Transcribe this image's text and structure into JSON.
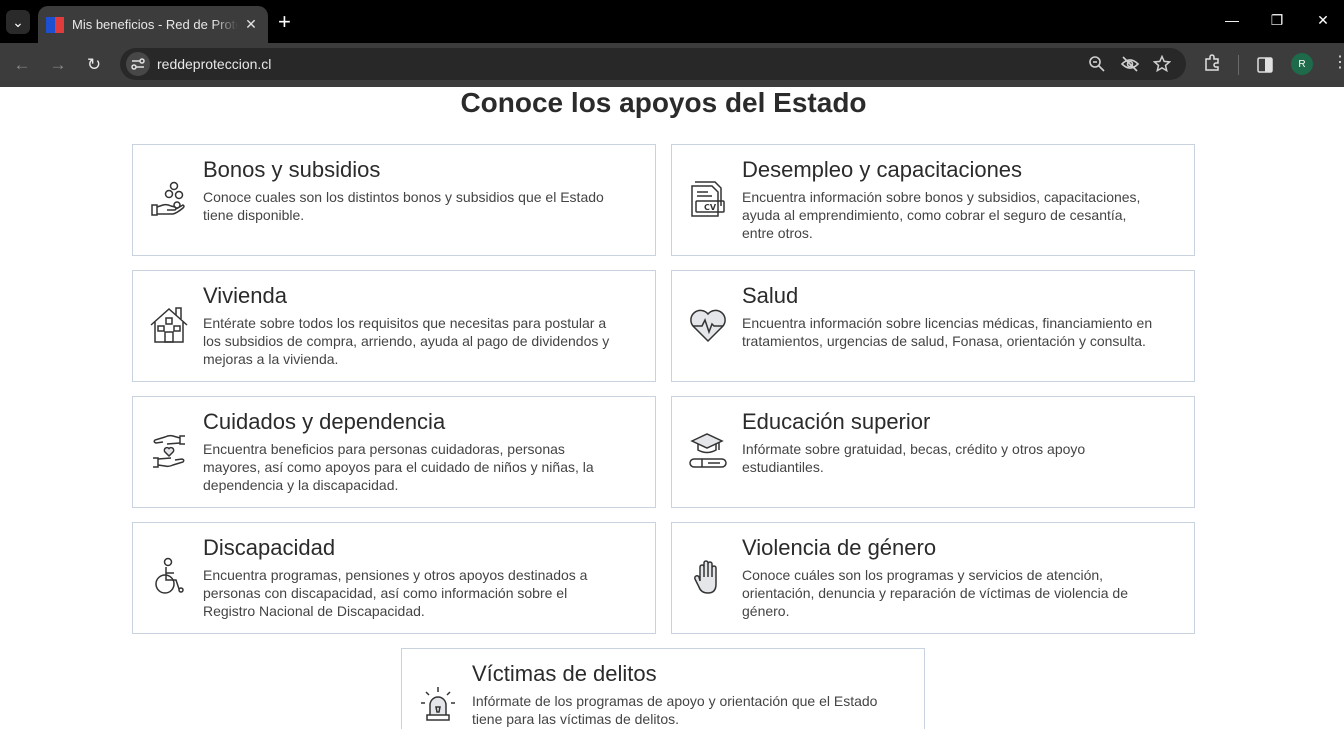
{
  "browser": {
    "tab_title": "Mis beneficios - Red de Protección",
    "tab_close": "✕",
    "new_tab": "+",
    "url": "reddeproteccion.cl",
    "profile_initial": "R",
    "tab_list": "⌄",
    "minimize": "—",
    "restore": "❐",
    "close": "✕",
    "back": "←",
    "forward": "→",
    "reload": "↻",
    "menu": "⋮"
  },
  "page": {
    "title": "Conoce los apoyos del Estado"
  },
  "cards": [
    {
      "title": "Bonos y subsidios",
      "desc": "Conoce cuales son los distintos bonos y subsidios que el Estado tiene disponible.",
      "icon": "coins-hand-icon"
    },
    {
      "title": "Desempleo y capacitaciones",
      "desc": "Encuentra información sobre bonos y subsidios, capacitaciones, ayuda al emprendimiento, como cobrar el seguro de cesantía, entre otros.",
      "icon": "cv-document-icon",
      "icon_text": "CV"
    },
    {
      "title": "Vivienda",
      "desc": "Entérate sobre todos los requisitos que necesitas para postular a los subsidios de compra, arriendo, ayuda al pago de dividendos y mejoras a la vivienda.",
      "icon": "house-icon"
    },
    {
      "title": "Salud",
      "desc": "Encuentra información sobre licencias médicas, financiamiento en tratamientos, urgencias de salud, Fonasa, orientación y consulta.",
      "icon": "heart-pulse-icon"
    },
    {
      "title": "Cuidados y dependencia",
      "desc": "Encuentra beneficios para personas cuidadoras, personas mayores, así como apoyos para el cuidado de niños y niñas, la dependencia y la discapacidad.",
      "icon": "caring-hands-icon"
    },
    {
      "title": "Educación superior",
      "desc": "Infórmate sobre gratuidad, becas, crédito y otros apoyo estudiantiles.",
      "icon": "graduation-cap-icon"
    },
    {
      "title": "Discapacidad",
      "desc": "Encuentra programas, pensiones y otros apoyos destinados a personas con discapacidad, así como información sobre el Registro Nacional de Discapacidad.",
      "icon": "wheelchair-icon"
    },
    {
      "title": "Violencia de género",
      "desc": "Conoce cuáles son los programas y servicios de atención, orientación, denuncia y reparación de víctimas de violencia de género.",
      "icon": "stop-hand-icon"
    },
    {
      "title": "Víctimas de delitos",
      "desc": "Infórmate de los programas de apoyo y orientación que el Estado tiene para las víctimas de delitos.",
      "icon": "alarm-siren-icon"
    }
  ],
  "colors": {
    "card_border": "#c9d3df",
    "title_text": "#2b2b2b",
    "chrome_dark": "#3c3c3c"
  }
}
